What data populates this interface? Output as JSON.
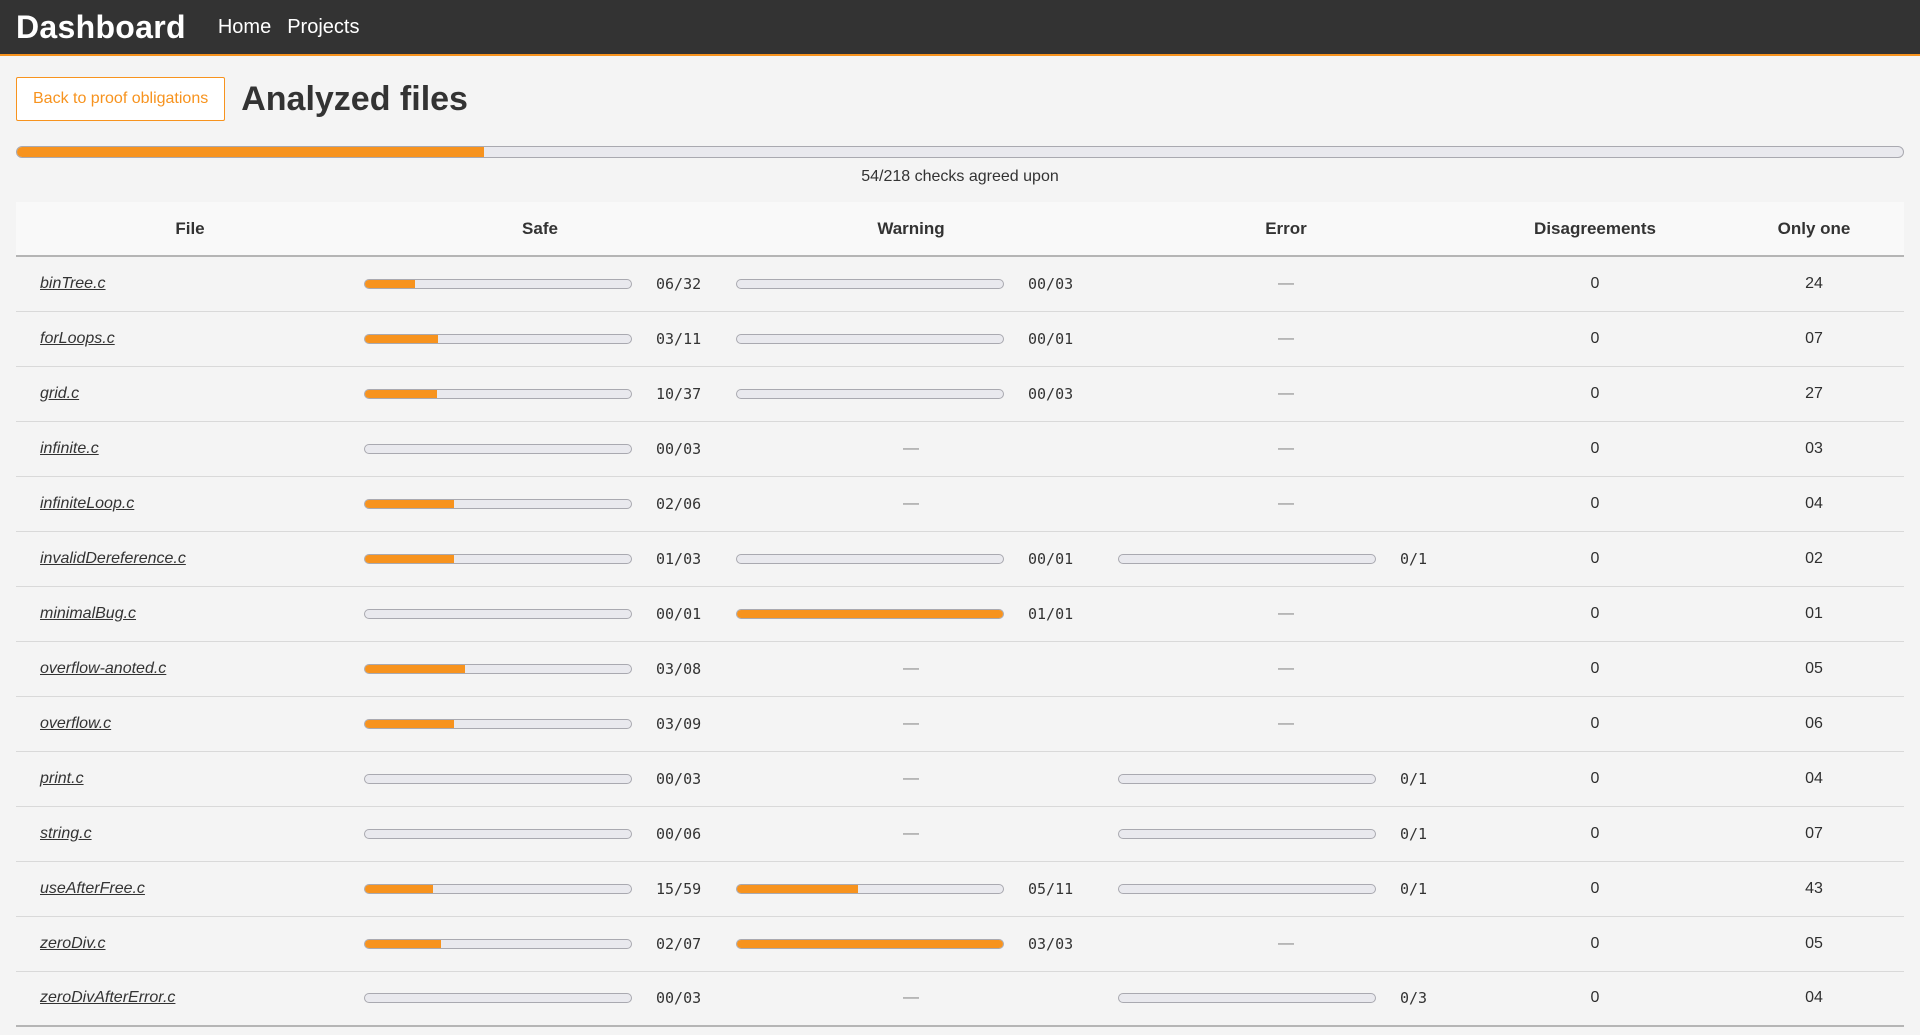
{
  "nav": {
    "brand": "Dashboard",
    "links": [
      "Home",
      "Projects"
    ]
  },
  "header": {
    "back_label": "Back to proof obligations",
    "title": "Analyzed files"
  },
  "overall": {
    "label": "54/218 checks agreed upon",
    "agreed": 54,
    "total": 218
  },
  "table": {
    "headers": [
      "File",
      "Safe",
      "Warning",
      "Error",
      "Disagreements",
      "Only one"
    ],
    "dash": "—",
    "rows": [
      {
        "file": "binTree.c",
        "safe": "06/32",
        "warning": "00/03",
        "error": null,
        "disagreements": "0",
        "only_one": "24"
      },
      {
        "file": "forLoops.c",
        "safe": "03/11",
        "warning": "00/01",
        "error": null,
        "disagreements": "0",
        "only_one": "07"
      },
      {
        "file": "grid.c",
        "safe": "10/37",
        "warning": "00/03",
        "error": null,
        "disagreements": "0",
        "only_one": "27"
      },
      {
        "file": "infinite.c",
        "safe": "00/03",
        "warning": null,
        "error": null,
        "disagreements": "0",
        "only_one": "03"
      },
      {
        "file": "infiniteLoop.c",
        "safe": "02/06",
        "warning": null,
        "error": null,
        "disagreements": "0",
        "only_one": "04"
      },
      {
        "file": "invalidDereference.c",
        "safe": "01/03",
        "warning": "00/01",
        "error": "0/1",
        "disagreements": "0",
        "only_one": "02"
      },
      {
        "file": "minimalBug.c",
        "safe": "00/01",
        "warning": "01/01",
        "error": null,
        "disagreements": "0",
        "only_one": "01"
      },
      {
        "file": "overflow-anoted.c",
        "safe": "03/08",
        "warning": null,
        "error": null,
        "disagreements": "0",
        "only_one": "05"
      },
      {
        "file": "overflow.c",
        "safe": "03/09",
        "warning": null,
        "error": null,
        "disagreements": "0",
        "only_one": "06"
      },
      {
        "file": "print.c",
        "safe": "00/03",
        "warning": null,
        "error": "0/1",
        "disagreements": "0",
        "only_one": "04"
      },
      {
        "file": "string.c",
        "safe": "00/06",
        "warning": null,
        "error": "0/1",
        "disagreements": "0",
        "only_one": "07"
      },
      {
        "file": "useAfterFree.c",
        "safe": "15/59",
        "warning": "05/11",
        "error": "0/1",
        "disagreements": "0",
        "only_one": "43"
      },
      {
        "file": "zeroDiv.c",
        "safe": "02/07",
        "warning": "03/03",
        "error": null,
        "disagreements": "0",
        "only_one": "05"
      },
      {
        "file": "zeroDivAfterError.c",
        "safe": "00/03",
        "warning": null,
        "error": "0/3",
        "disagreements": "0",
        "only_one": "04"
      }
    ]
  },
  "colors": {
    "accent": "#f7931e",
    "navbar": "#333333",
    "track": "#e9e9ee"
  }
}
